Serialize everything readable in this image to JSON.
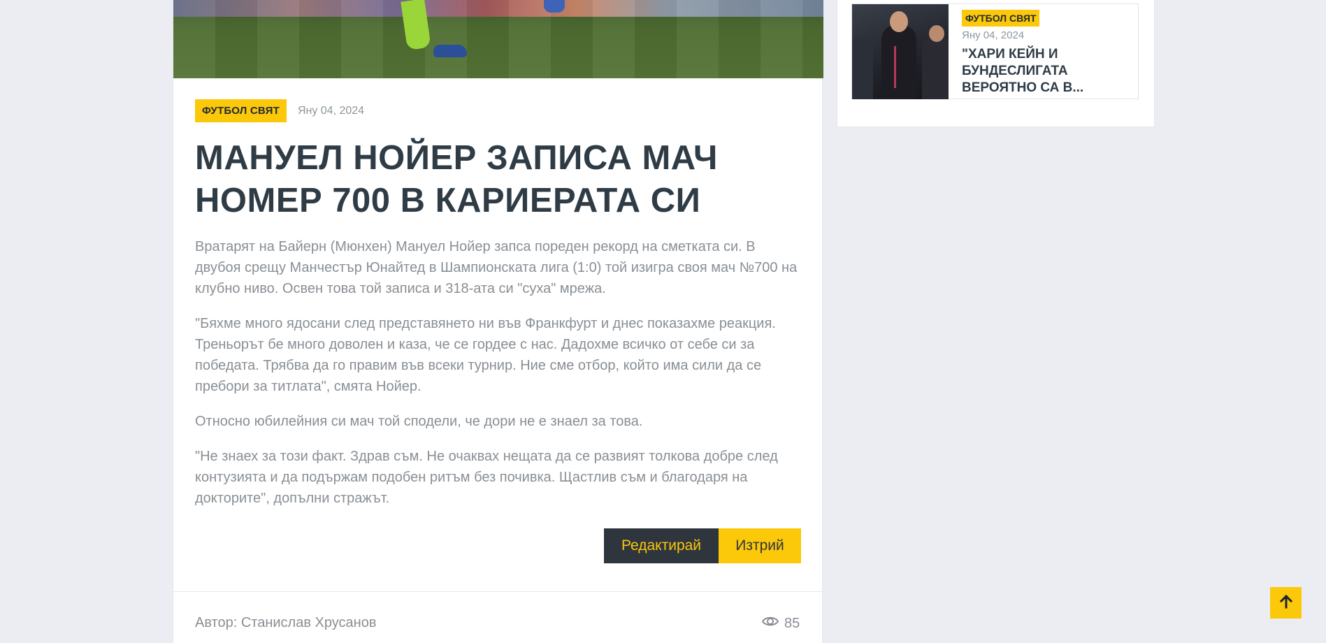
{
  "article": {
    "category": "ФУТБОЛ СВЯТ",
    "date": "Яну 04, 2024",
    "title": "МАНУЕЛ НОЙЕР ЗАПИСА МАЧ НОМЕР 700 В КАРИЕРАТА СИ",
    "paragraphs": [
      "Вратарят на Байерн (Мюнхен) Мануел Нойер запса пореден рекорд на сметката си. В двубоя срещу Манчестър Юнайтед в Шампионската лига (1:0) той изигра своя мач №700 на клубно ниво. Освен това той записа и 318-ата си \"суха\" мрежа.",
      "\"Бяхме много ядосани след представянето ни във Франкфурт и днес показахме реакция. Треньорът бе много доволен и каза, че се гордее с нас. Дадохме всичко от себе си за победата. Трябва да го правим във всеки турнир. Ние сме отбор, който има сили да се пребори за титлата\", смята Нойер.",
      "Относно юбилейния си мач той сподели, че дори не е знаел за това.",
      "\"Не знаех за този факт. Здрав съм. Не очаквах нещата да се развият толкова добре след контузията и да подържам подобен ритъм без почивка. Щастлив съм и благодаря на докторите\", допълни стражът."
    ],
    "edit_label": "Редактирай",
    "delete_label": "Изтрий",
    "author": "Автор: Станислав Хрусанов",
    "views": "85"
  },
  "sidebar": {
    "card": {
      "category": "ФУТБОЛ СВЯТ",
      "date": "Яну 04, 2024",
      "title": "\"ХАРИ КЕЙН И БУНДЕСЛИГАТА ВЕРОЯТНО СА В..."
    }
  },
  "icons": {
    "views": "eye-icon",
    "scroll_top": "arrow-up-icon"
  },
  "colors": {
    "accent": "#fcc80a",
    "dark": "#2e353d",
    "text_muted": "#898f95",
    "heading": "#2f3c46",
    "page_bg": "#ecedf3"
  }
}
